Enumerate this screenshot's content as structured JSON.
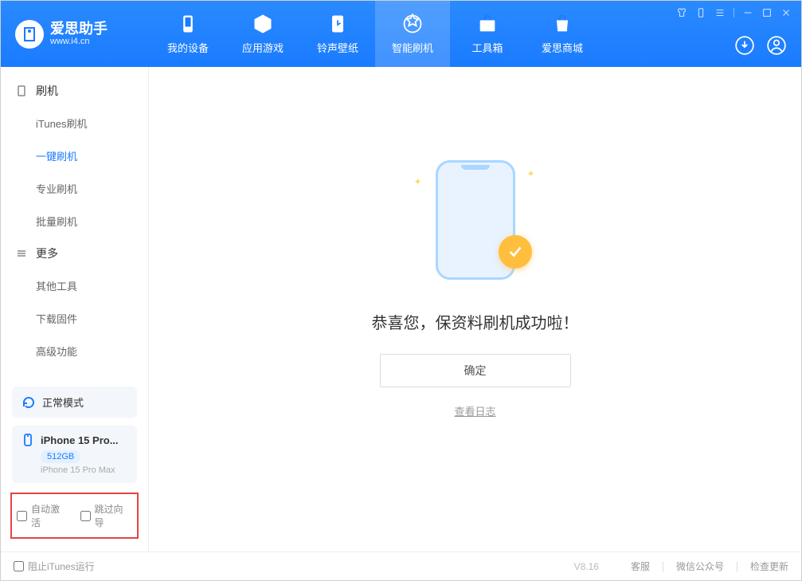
{
  "logo": {
    "title": "爱思助手",
    "sub": "www.i4.cn"
  },
  "tabs": [
    {
      "label": "我的设备"
    },
    {
      "label": "应用游戏"
    },
    {
      "label": "铃声壁纸"
    },
    {
      "label": "智能刷机"
    },
    {
      "label": "工具箱"
    },
    {
      "label": "爱思商城"
    }
  ],
  "sidebar": {
    "group1": {
      "title": "刷机",
      "items": [
        "iTunes刷机",
        "一键刷机",
        "专业刷机",
        "批量刷机"
      ]
    },
    "group2": {
      "title": "更多",
      "items": [
        "其他工具",
        "下载固件",
        "高级功能"
      ]
    },
    "status": "正常模式",
    "device": {
      "name": "iPhone 15 Pro...",
      "storage": "512GB",
      "model": "iPhone 15 Pro Max"
    },
    "checks": {
      "autoActivate": "自动激活",
      "skipWizard": "跳过向导"
    }
  },
  "main": {
    "message": "恭喜您，保资料刷机成功啦！",
    "confirm": "确定",
    "viewLog": "查看日志"
  },
  "footer": {
    "blockItunes": "阻止iTunes运行",
    "version": "V8.16",
    "links": [
      "客服",
      "微信公众号",
      "检查更新"
    ]
  }
}
